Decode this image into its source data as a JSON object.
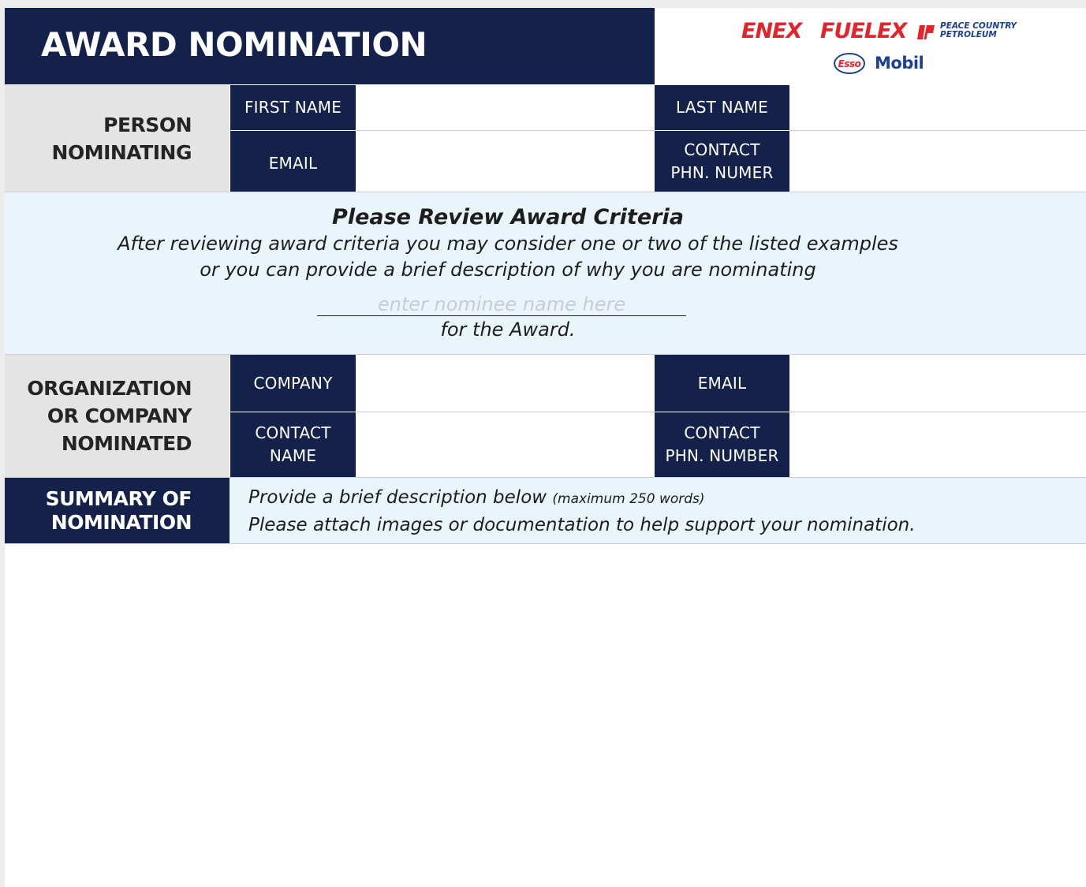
{
  "header": {
    "title": "AWARD NOMINATION",
    "logos": {
      "enex": "ENEX",
      "fuelex": "FUELEX",
      "peace_country_line1": "PEACE COUNTRY",
      "peace_country_line2": "PETROLEUM",
      "esso": "Esso",
      "mobil": "Mobil"
    }
  },
  "nominator": {
    "heading_line1": "PERSON",
    "heading_line2": "NOMINATING",
    "first_name_label": "FIRST NAME",
    "last_name_label": "LAST NAME",
    "email_label": "EMAIL",
    "phone_label_line1": "CONTACT",
    "phone_label_line2": "PHN. NUMER"
  },
  "criteria": {
    "title": "Please Review Award Criteria",
    "line1": "After reviewing award criteria you may consider one or two of the listed examples",
    "line2": "or you can provide a brief description of why you are nominating",
    "nominee_placeholder": "enter nominee name here",
    "for_award": "for the Award."
  },
  "nominee": {
    "heading_line1": "ORGANIZATION",
    "heading_line2": "OR COMPANY",
    "heading_line3": "NOMINATED",
    "company_label": "COMPANY",
    "email_label": "EMAIL",
    "contact_name_line1": "CONTACT",
    "contact_name_line2": "NAME",
    "phone_label_line1": "CONTACT",
    "phone_label_line2": "PHN. NUMBER"
  },
  "summary": {
    "heading_line1": "SUMMARY OF",
    "heading_line2": "NOMINATION",
    "instruction_main": "Provide a brief description below",
    "instruction_note": "(maximum 250 words)",
    "instruction_line2": "Please attach images or documentation to help support your nomination."
  },
  "colors": {
    "navy": "#14214a",
    "light_blue": "#eaf5fb",
    "grey": "#e4e4e4",
    "logo_red": "#e3242b",
    "logo_blue": "#1c3f94"
  }
}
